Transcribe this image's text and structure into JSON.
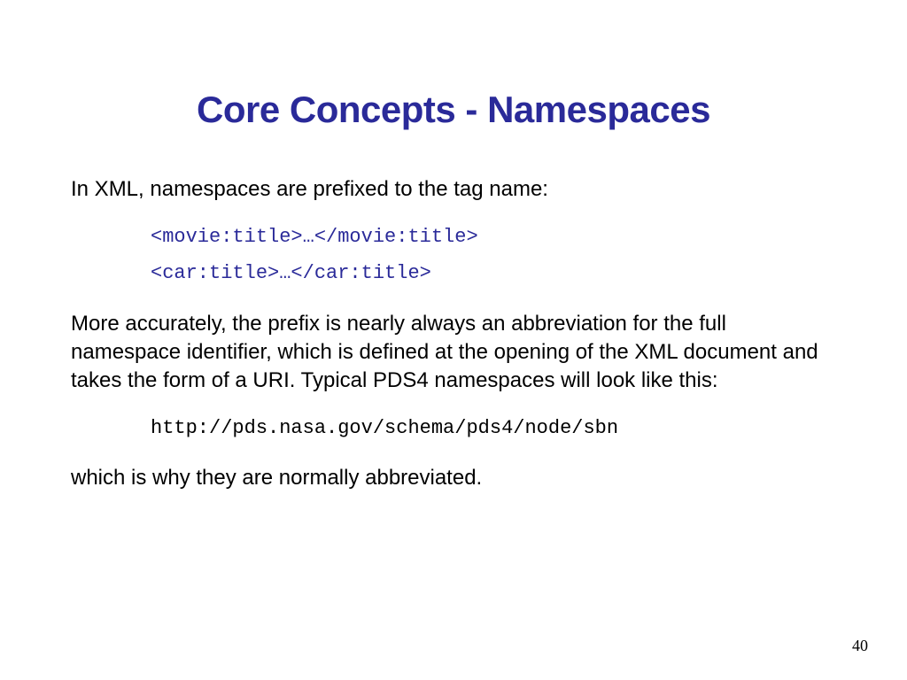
{
  "slide": {
    "title": "Core Concepts - Namespaces",
    "intro": "In XML, namespaces are prefixed to the tag name:",
    "code1": "<movie:title>…</movie:title>",
    "code2": "<car:title>…</car:title>",
    "explanation": "More accurately, the prefix is nearly always an abbreviation for the full namespace identifier, which is defined at the opening of the XML document and takes the form of a URI.  Typical PDS4 namespaces will look like this:",
    "uri": "http://pds.nasa.gov/schema/pds4/node/sbn",
    "closing": "which is why they are normally abbreviated.",
    "page_number": "40"
  }
}
